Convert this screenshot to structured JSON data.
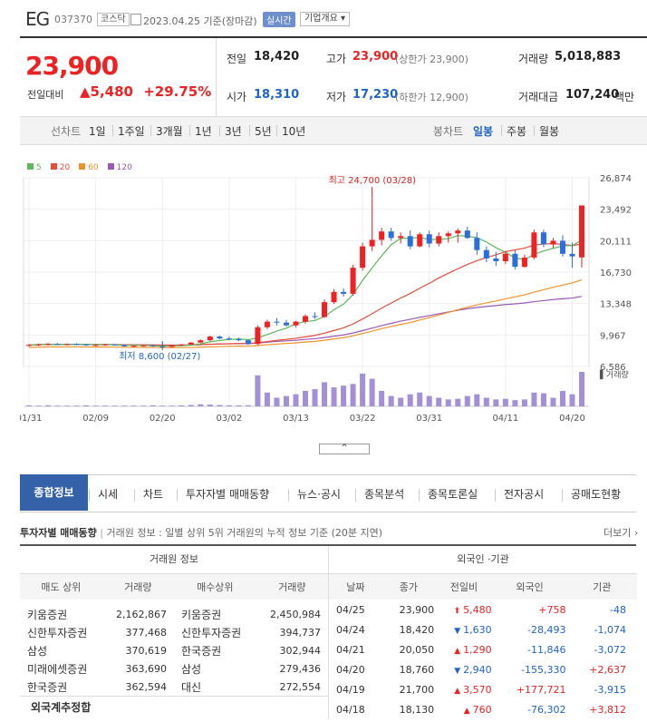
{
  "header": {
    "name": "EG",
    "code": "037370",
    "market": "코스닥",
    "date": "2023.04.25 기준(장마감)",
    "realtime": "실시간",
    "overview": "기업개요 ▾"
  },
  "quote": {
    "price": "23,900",
    "change_label": "전일대비",
    "change_arrow": "▲",
    "change": "5,480",
    "change_pct": "+29.75%",
    "prev_label": "전일",
    "prev": "18,420",
    "high_label": "고가",
    "high": "23,900",
    "high_sub": "(상한가 23,900)",
    "volume_label": "거래량",
    "volume": "5,018,883",
    "open_label": "시가",
    "open": "18,310",
    "low_label": "저가",
    "low": "17,230",
    "low_sub": "(하한가 12,900)",
    "amount_label": "거래대금",
    "amount": "107,240",
    "amount_unit": "백만"
  },
  "periods": {
    "line_label": "선차트",
    "items": [
      "1일",
      "1주일",
      "3개월",
      "1년",
      "3년",
      "5년",
      "10년"
    ],
    "candle_label": "봉차트",
    "candle_items": [
      "일봉",
      "주봉",
      "월봉"
    ]
  },
  "chart_data": {
    "type": "candlestick",
    "ma_legend": [
      {
        "label": "5",
        "color": "#5cb85c"
      },
      {
        "label": "20",
        "color": "#e74c3c"
      },
      {
        "label": "60",
        "color": "#f0932b"
      },
      {
        "label": "120",
        "color": "#9b59b6"
      }
    ],
    "y_ticks": [
      "26,874",
      "23,492",
      "20,111",
      "16,730",
      "13,348",
      "9,967",
      "6,586"
    ],
    "x_ticks": [
      "01/31",
      "02/09",
      "02/20",
      "03/02",
      "03/13",
      "03/22",
      "03/31",
      "04/11",
      "04/20"
    ],
    "high_annotation": "최고 24,700 (03/28)",
    "low_annotation": "최저 8,600 (02/27)",
    "volume_label": "거래량",
    "candles": [
      [
        8800,
        9000,
        8700,
        8900
      ],
      [
        8900,
        9050,
        8800,
        8950
      ],
      [
        8950,
        9100,
        8850,
        9000
      ],
      [
        9000,
        9100,
        8900,
        8950
      ],
      [
        8950,
        9050,
        8850,
        9000
      ],
      [
        9000,
        9100,
        8900,
        8950
      ],
      [
        8950,
        9000,
        8800,
        8850
      ],
      [
        8850,
        8950,
        8750,
        8900
      ],
      [
        8900,
        9000,
        8800,
        8950
      ],
      [
        8950,
        9000,
        8850,
        8900
      ],
      [
        8900,
        8950,
        8700,
        8750
      ],
      [
        8750,
        8850,
        8650,
        8800
      ],
      [
        8800,
        8900,
        8700,
        8850
      ],
      [
        8850,
        8900,
        8700,
        8750
      ],
      [
        8750,
        8800,
        8600,
        8700
      ],
      [
        8700,
        8900,
        8600,
        8850
      ],
      [
        8850,
        9000,
        8800,
        8950
      ],
      [
        8950,
        9200,
        8900,
        9150
      ],
      [
        9150,
        9500,
        9100,
        9400
      ],
      [
        9400,
        9900,
        9300,
        9800
      ],
      [
        9800,
        9900,
        9500,
        9600
      ],
      [
        9600,
        9800,
        9400,
        9500
      ],
      [
        9500,
        9700,
        9300,
        9400
      ],
      [
        9400,
        9500,
        8900,
        9000
      ],
      [
        9000,
        11000,
        8900,
        10800
      ],
      [
        10800,
        11600,
        10600,
        11400
      ],
      [
        11400,
        11800,
        11000,
        11300
      ],
      [
        11300,
        11600,
        10900,
        11000
      ],
      [
        11000,
        11500,
        10800,
        11400
      ],
      [
        11400,
        12200,
        11200,
        12000
      ],
      [
        12000,
        12400,
        11700,
        11900
      ],
      [
        11900,
        13800,
        11800,
        13500
      ],
      [
        13500,
        14900,
        13300,
        14600
      ],
      [
        14600,
        15000,
        14100,
        14400
      ],
      [
        14400,
        17500,
        14200,
        17200
      ],
      [
        17200,
        19900,
        16900,
        19500
      ],
      [
        19500,
        24700,
        19000,
        20200
      ],
      [
        20200,
        21500,
        19600,
        21100
      ],
      [
        21100,
        21500,
        20100,
        20400
      ],
      [
        20400,
        21000,
        19800,
        20600
      ],
      [
        20600,
        21200,
        19200,
        19500
      ],
      [
        19500,
        21000,
        19400,
        20800
      ],
      [
        20800,
        21200,
        19400,
        19800
      ],
      [
        19800,
        21000,
        19500,
        20600
      ],
      [
        20600,
        21100,
        19900,
        20900
      ],
      [
        20900,
        21400,
        19900,
        21200
      ],
      [
        21200,
        21600,
        20300,
        20400
      ],
      [
        20400,
        21000,
        18600,
        19100
      ],
      [
        19100,
        19500,
        17800,
        18200
      ],
      [
        18200,
        18900,
        17400,
        17900
      ],
      [
        17900,
        19000,
        17600,
        18700
      ],
      [
        18700,
        19100,
        17000,
        17300
      ],
      [
        17300,
        18600,
        17200,
        18300
      ],
      [
        18300,
        21300,
        18100,
        21000
      ],
      [
        21000,
        21300,
        19400,
        19700
      ],
      [
        19700,
        20400,
        19300,
        20100
      ],
      [
        20100,
        20700,
        18400,
        18700
      ],
      [
        18700,
        19900,
        17200,
        18420
      ],
      [
        18310,
        23900,
        17230,
        23900
      ]
    ],
    "volumes": [
      3,
      2,
      3,
      2,
      2,
      2,
      3,
      2,
      2,
      2,
      2,
      2,
      2,
      3,
      2,
      2,
      3,
      4,
      6,
      5,
      4,
      3,
      3,
      3,
      90,
      40,
      25,
      30,
      35,
      45,
      50,
      70,
      55,
      60,
      65,
      95,
      80,
      45,
      30,
      25,
      35,
      40,
      30,
      25,
      20,
      22,
      30,
      35,
      25,
      20,
      22,
      18,
      20,
      40,
      38,
      25,
      45,
      35,
      100
    ]
  },
  "tabs": [
    "종합정보",
    "시세",
    "차트",
    "투자자별 매매동향",
    "뉴스·공시",
    "종목분석",
    "종목토론실",
    "전자공시",
    "공매도현황"
  ],
  "section": {
    "title": "투자자별 매매동향",
    "desc": "거래원 정보 : 일별 상위 5위 거래원의 누적 정보 기준 (20분 지연)",
    "more": "더보기 ›",
    "broker_title": "거래원 정보",
    "foreign_title": "외국인 ·기관",
    "broker_headers": [
      "매도 상위",
      "거래량",
      "매수상위",
      "거래량"
    ],
    "broker_rows": [
      [
        "키움증권",
        "2,162,867",
        "키움증권",
        "2,450,984"
      ],
      [
        "신한투자증권",
        "377,468",
        "신한투자증권",
        "394,737"
      ],
      [
        "삼성",
        "370,619",
        "한국증권",
        "302,944"
      ],
      [
        "미래에셋증권",
        "363,690",
        "삼성",
        "279,436"
      ],
      [
        "한국증권",
        "362,594",
        "대신",
        "272,554"
      ]
    ],
    "foreign_total": "외국계추정합",
    "foreign_headers": [
      "날짜",
      "종가",
      "전일비",
      "외국인",
      "기관"
    ],
    "foreign_rows": [
      [
        "04/25",
        "23,900",
        "⬆",
        "5,480",
        "+758",
        "-48"
      ],
      [
        "04/24",
        "18,420",
        "▼",
        "1,630",
        "-28,493",
        "-1,074"
      ],
      [
        "04/21",
        "20,050",
        "▲",
        "1,290",
        "-11,846",
        "-3,072"
      ],
      [
        "04/20",
        "18,760",
        "▼",
        "2,940",
        "-155,330",
        "+2,637"
      ],
      [
        "04/19",
        "21,700",
        "▲",
        "3,570",
        "+177,721",
        "-3,915"
      ],
      [
        "04/18",
        "18,130",
        "▲",
        "760",
        "-76,302",
        "+3,812"
      ]
    ]
  }
}
